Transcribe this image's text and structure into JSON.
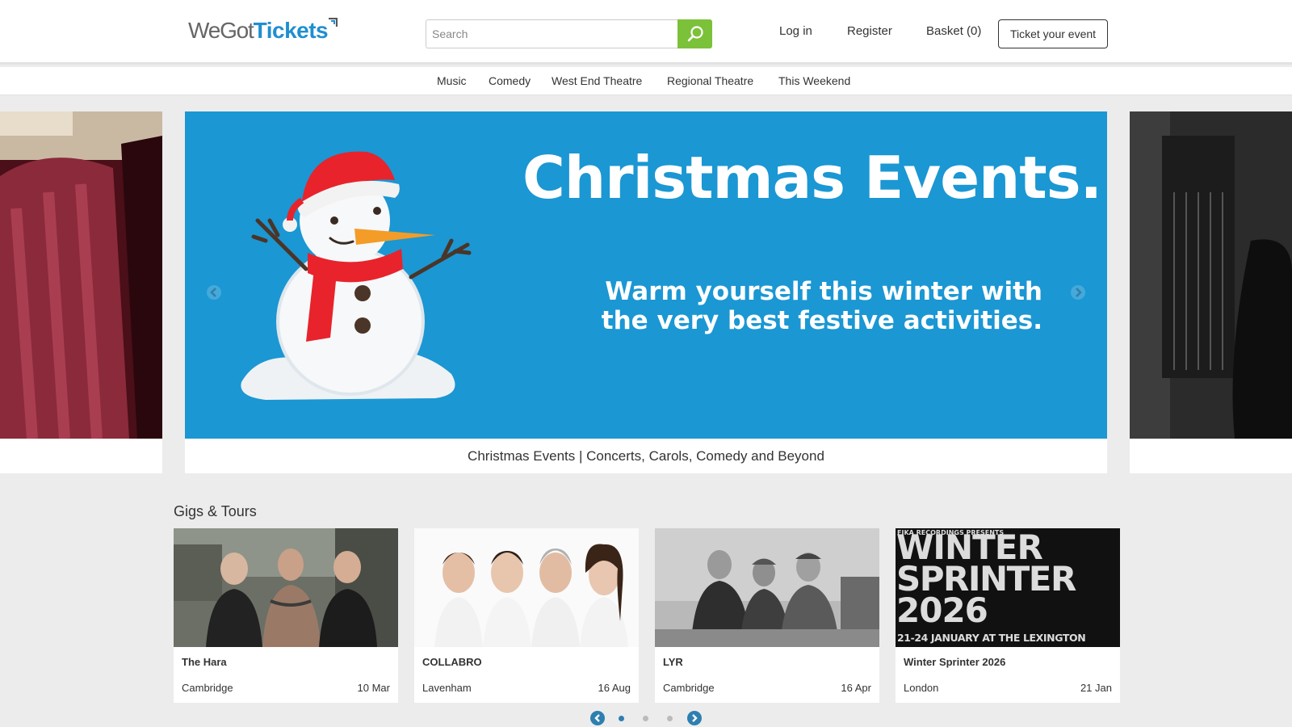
{
  "header": {
    "logo_part1": "WeGot",
    "logo_part2": "Tickets",
    "search_placeholder": "Search",
    "search_value": "",
    "login_label": "Log in",
    "register_label": "Register",
    "basket_label": "Basket (0)",
    "ticket_event_label": "Ticket your event"
  },
  "categories": [
    "Music",
    "Comedy",
    "West End Theatre",
    "Regional Theatre",
    "This Weekend"
  ],
  "carousel": {
    "banner_title": "Christmas Events.",
    "banner_line1": "Warm yourself this winter with",
    "banner_line2": "the very best festive activities.",
    "caption": "Christmas Events | Concerts, Carols, Comedy and Beyond"
  },
  "gigs": {
    "section_title": "Gigs & Tours",
    "cards": [
      {
        "name": "The Hara",
        "city": "Cambridge",
        "date": "10 Mar"
      },
      {
        "name": "COLLABRO",
        "city": "Lavenham",
        "date": "16 Aug"
      },
      {
        "name": "LYR",
        "city": "Cambridge",
        "date": "16 Apr"
      },
      {
        "name": "Winter Sprinter 2026",
        "city": "London",
        "date": "21 Jan"
      }
    ],
    "poster_top": "FIKA RECORDINGS PRESENTS",
    "poster_line1": "WINTER",
    "poster_line2": "SPRINTER",
    "poster_line3": "2026",
    "poster_bottom": "21-24 JANUARY AT THE LEXINGTON",
    "pager_active": 1,
    "pager_count": 3
  },
  "colors": {
    "brand_blue": "#1f8fd0",
    "search_green": "#7cc13a",
    "banner_blue": "#1b97d3",
    "pager_blue": "#2e7fb0"
  },
  "icons": [
    "search-icon",
    "chevron-left-icon",
    "chevron-right-icon"
  ]
}
